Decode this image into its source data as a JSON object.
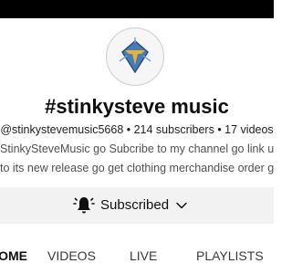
{
  "channel": {
    "name": "#stinkysteve music",
    "handle": "@stinkystevemusic5668",
    "subscribers": "214 subscribers",
    "videos": "17 videos",
    "meta_line": "@stinkystevemusic5668 • 214 subscribers • 17 videos",
    "description_line_1": "StinkySteveMusic go Subcribe to my channel go link up",
    "description_line_2": "to its new release go get clothing merchandise order go"
  },
  "subscribe": {
    "label": "Subscribed",
    "icon": "bell-ringing-icon"
  },
  "tabs": [
    {
      "label": "HOME"
    },
    {
      "label": "VIDEOS"
    },
    {
      "label": "LIVE"
    },
    {
      "label": "PLAYLISTS"
    }
  ],
  "colors": {
    "top_bar": "#000000",
    "subscribe_bar": "#f2f2f2",
    "text_primary": "#0f0f0f",
    "text_secondary": "#505050",
    "logo_accent": "#e0b43a",
    "logo_blue": "#4a7bb8"
  }
}
